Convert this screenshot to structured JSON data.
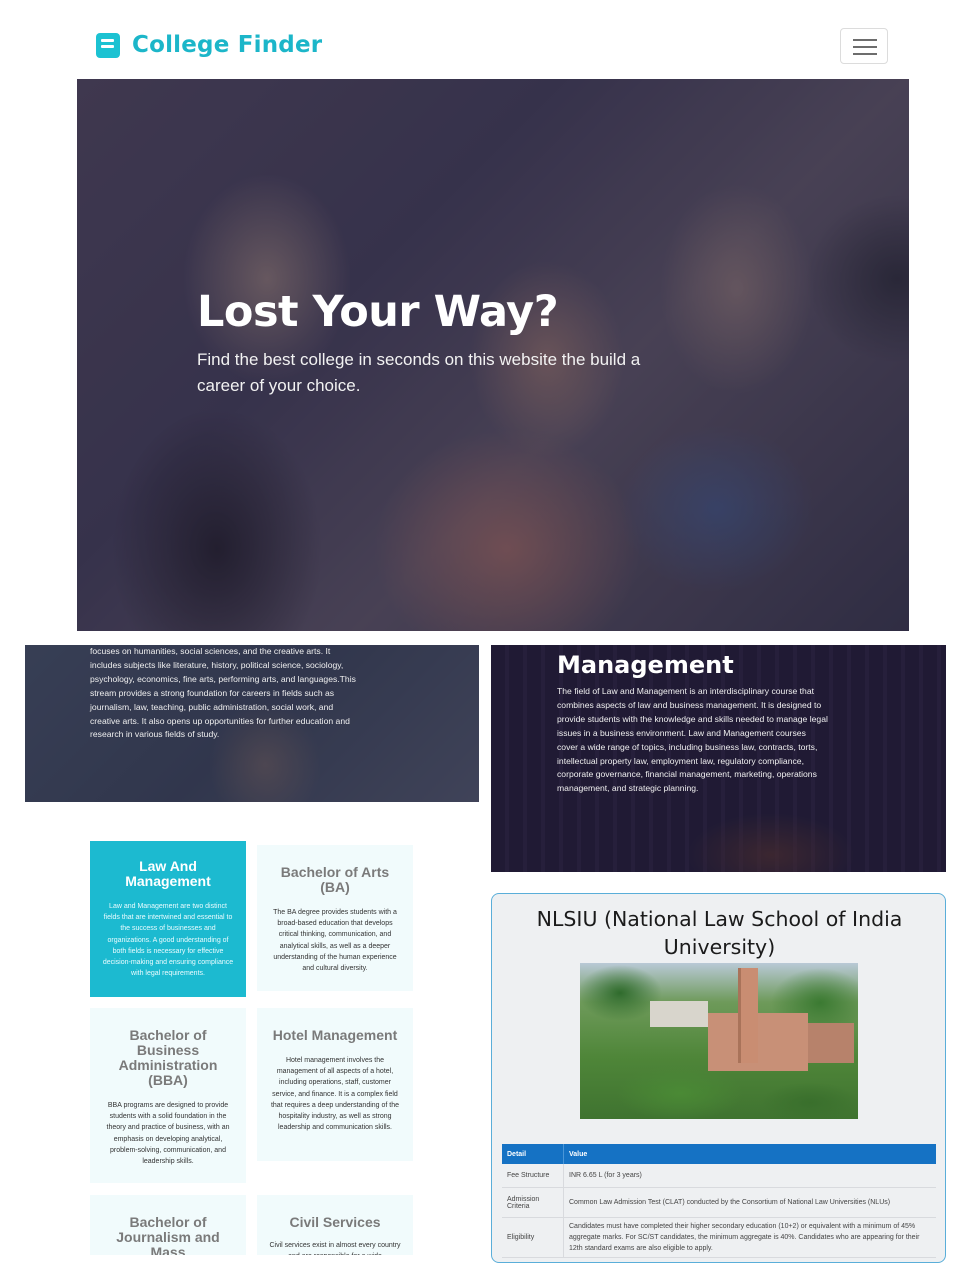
{
  "navbar": {
    "brand_name": "College Finder",
    "brand_icon": "book-icon",
    "menu_icon": "hamburger-icon"
  },
  "hero": {
    "title": "Lost Your Way?",
    "subtitle": "Find the best college in seconds on this website the build a career of your choice."
  },
  "streams": {
    "arts_text": "focuses on humanities, social sciences, and the creative arts. It includes subjects like literature, history, political science, sociology, psychology, economics, fine arts, performing arts, and languages.This stream provides a strong foundation for careers in fields such as journalism, law, teaching, public administration, social work, and creative arts. It also opens up opportunities for further education and research in various fields of study.",
    "law_title": "Management",
    "law_text": "The field of Law and Management is an interdisciplinary course that combines aspects of law and business management. It is designed to provide students with the knowledge and skills needed to manage legal issues in a business environment. Law and Management courses cover a wide range of topics, including business law, contracts, torts, intellectual property law, employment law, regulatory compliance, corporate governance, financial management, marketing, operations management, and strategic planning."
  },
  "courses": [
    {
      "title": "Law And Management",
      "text": "Law and Management are two distinct fields that are intertwined and essential to the success of businesses and organizations. A good understanding of both fields is necessary for effective decision-making and ensuring compliance with legal requirements."
    },
    {
      "title": "Bachelor of Arts (BA)",
      "text": "The BA degree provides students with a broad-based education that develops critical thinking, communication, and analytical skills, as well as a deeper understanding of the human experience and cultural diversity."
    },
    {
      "title": "Bachelor of Business Administration (BBA)",
      "text": "BBA programs are designed to provide students with a solid foundation in the theory and practice of business, with an emphasis on developing analytical, problem-solving, communication, and leadership skills."
    },
    {
      "title": "Hotel Management",
      "text": "Hotel management involves the management of all aspects of a hotel, including operations, staff, customer service, and finance. It is a complex field that requires a deep understanding of the hospitality industry, as well as strong leadership and communication skills."
    },
    {
      "title": "Bachelor of Journalism and Mass",
      "text": ""
    },
    {
      "title": "Civil Services",
      "text": "Civil services exist in almost every country and are responsible for a wide"
    }
  ],
  "college": {
    "name": "NLSIU (National Law School of India University)",
    "table": {
      "headers": [
        "Detail",
        "Value"
      ],
      "rows": [
        [
          "Fee Structure",
          "INR 6.65 L (for 3 years)"
        ],
        [
          "Admission Criteria",
          "Common Law Admission Test (CLAT) conducted by the Consortium of National Law Universities (NLUs)"
        ],
        [
          "Eligibility",
          "Candidates must have completed their higher secondary education (10+2) or equivalent with a minimum of 45% aggregate marks. For SC/ST candidates, the minimum aggregate is 40%. Candidates who are appearing for their 12th standard exams are also eligible to apply."
        ]
      ]
    }
  },
  "colors": {
    "brand": "#1cb6c9",
    "card_active": "#1cbad0",
    "table_header": "#1572c4"
  }
}
